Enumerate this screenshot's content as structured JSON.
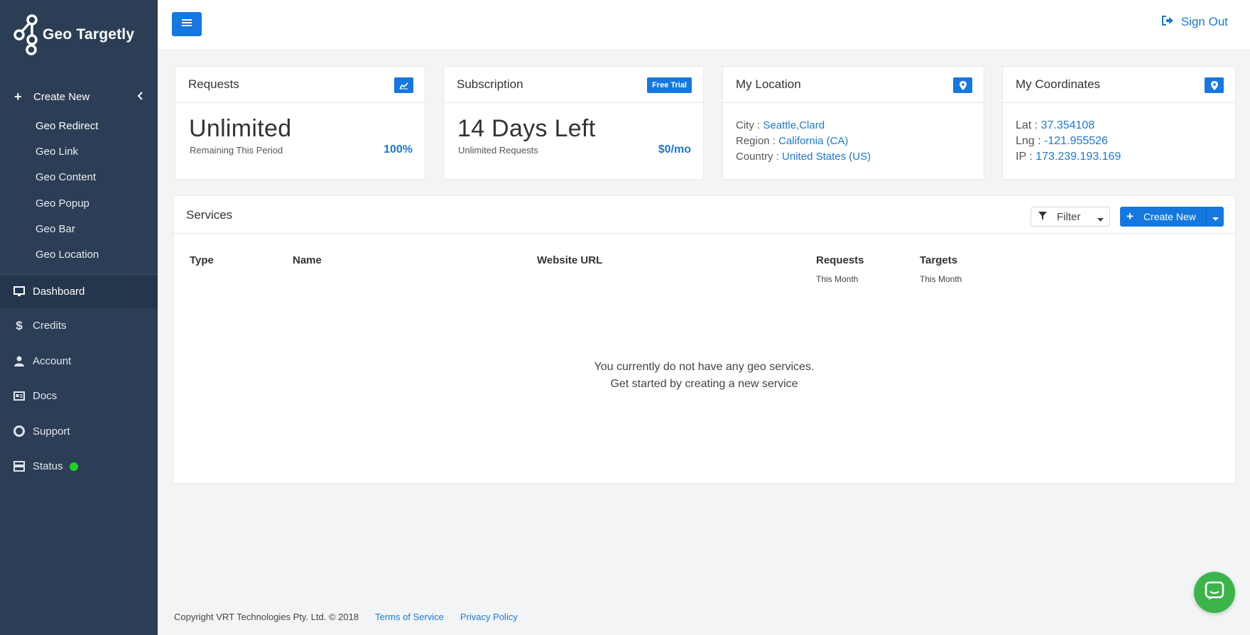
{
  "app": {
    "name": "Geo Targetly"
  },
  "sidebar": {
    "create_new": "Create New",
    "sub_items": [
      {
        "label": "Geo Redirect"
      },
      {
        "label": "Geo Link"
      },
      {
        "label": "Geo Content"
      },
      {
        "label": "Geo Popup"
      },
      {
        "label": "Geo Bar"
      },
      {
        "label": "Geo Location"
      }
    ],
    "nav": [
      {
        "label": "Dashboard",
        "icon": "monitor-icon",
        "active": true
      },
      {
        "label": "Credits",
        "icon": "dollar-icon"
      },
      {
        "label": "Account",
        "icon": "user-icon"
      },
      {
        "label": "Docs",
        "icon": "docs-icon"
      },
      {
        "label": "Support",
        "icon": "lifebuoy-icon"
      },
      {
        "label": "Status",
        "icon": "status-icon",
        "status_color": "#1ed41e"
      }
    ]
  },
  "topbar": {
    "sign_out": "Sign Out"
  },
  "cards": {
    "requests": {
      "title": "Requests",
      "value": "Unlimited",
      "sub": "Remaining This Period",
      "right": "100%"
    },
    "subscription": {
      "title": "Subscription",
      "badge": "Free Trial",
      "value": "14 Days Left",
      "sub": "Unlimited Requests",
      "right": "$0/mo"
    },
    "location": {
      "title": "My Location",
      "city_label": "City",
      "city": "Seattle,Clard",
      "region_label": "Region",
      "region": "California (CA)",
      "country_label": "Country",
      "country": "United States (US)"
    },
    "coordinates": {
      "title": "My Coordinates",
      "lat_label": "Lat",
      "lat": "37.354108",
      "lng_label": "Lng",
      "lng": "-121.955526",
      "ip_label": "IP",
      "ip": "173.239.193.169"
    }
  },
  "services": {
    "title": "Services",
    "filter": "Filter",
    "create_new": "Create New",
    "columns": [
      {
        "label": "Type",
        "sub": ""
      },
      {
        "label": "Name",
        "sub": ""
      },
      {
        "label": "Website URL",
        "sub": ""
      },
      {
        "label": "Requests",
        "sub": "This Month"
      },
      {
        "label": "Targets",
        "sub": "This Month"
      }
    ],
    "empty_line1": "You currently do not have any geo services.",
    "empty_line2": "Get started by creating a new service"
  },
  "footer": {
    "copyright": "Copyright VRT Technologies Pty. Ltd. © 2018",
    "terms": "Terms of Service",
    "privacy": "Privacy Policy"
  },
  "colors": {
    "accent": "#1478e0",
    "sidebar": "#2c3e55",
    "link": "#1b79d8",
    "chat": "#3bb54a"
  }
}
